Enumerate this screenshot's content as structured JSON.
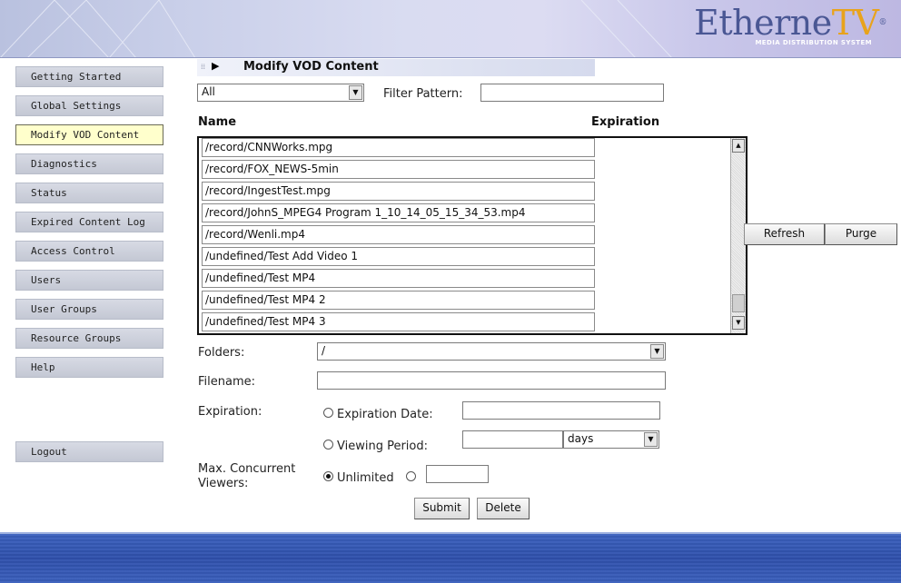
{
  "header": {
    "logo_main": "Etherne",
    "logo_accent": "TV",
    "logo_reg": "®",
    "logo_sub": "MEDIA DISTRIBUTION SYSTEM"
  },
  "sidebar": {
    "items": [
      {
        "label": "Getting Started"
      },
      {
        "label": "Global Settings"
      },
      {
        "label": "Modify VOD Content"
      },
      {
        "label": "Diagnostics"
      },
      {
        "label": "Status"
      },
      {
        "label": "Expired Content Log"
      },
      {
        "label": "Access Control"
      },
      {
        "label": "Users"
      },
      {
        "label": "User Groups"
      },
      {
        "label": "Resource Groups"
      },
      {
        "label": "Help"
      }
    ],
    "active_index": 2,
    "logout_label": "Logout"
  },
  "panel": {
    "title": "Modify VOD Content",
    "filter_select_value": "All",
    "filter_pattern_label": "Filter Pattern:",
    "filter_pattern_value": "",
    "col_name": "Name",
    "col_expiration": "Expiration"
  },
  "files": [
    "/record/CNNWorks.mpg",
    "/record/FOX_NEWS-5min",
    "/record/IngestTest.mpg",
    "/record/JohnS_MPEG4 Program 1_10_14_05_15_34_53.mp4",
    "/record/Wenli.mp4",
    "/undefined/Test Add Video 1",
    "/undefined/Test MP4",
    "/undefined/Test MP4 2",
    "/undefined/Test MP4 3"
  ],
  "actions": {
    "refresh_label": "Refresh",
    "purge_label": "Purge"
  },
  "form": {
    "folders_label": "Folders:",
    "folders_value": "/",
    "filename_label": "Filename:",
    "filename_value": "",
    "expiration_label": "Expiration:",
    "expiration_date_label": "Expiration Date:",
    "expiration_date_value": "",
    "viewing_period_label": "Viewing Period:",
    "viewing_period_value": "",
    "period_unit": "days",
    "max_viewers_label_1": "Max. Concurrent",
    "max_viewers_label_2": "Viewers:",
    "unlimited_label": "Unlimited",
    "unlimited_checked": true,
    "custom_viewers_value": "",
    "submit_label": "Submit",
    "delete_label": "Delete"
  }
}
